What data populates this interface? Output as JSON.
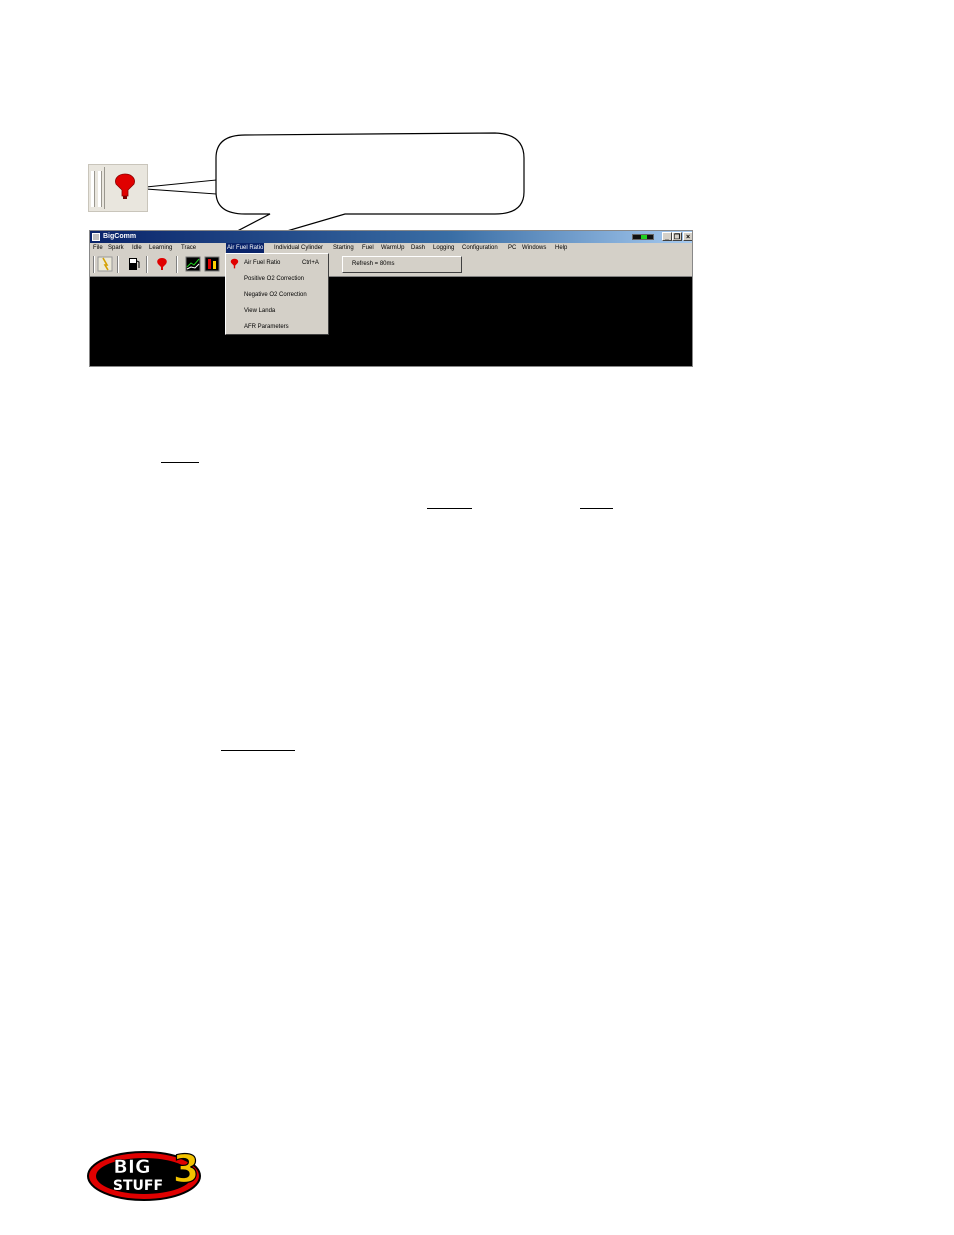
{
  "callout": {
    "text": "",
    "icon": "air-fuel-ratio-icon"
  },
  "window": {
    "title": "BigComm",
    "controls": {
      "minimize": "_",
      "restore": "❐",
      "close": "×"
    }
  },
  "menubar": {
    "items": [
      "File",
      "Spark",
      "Idle",
      "Learning",
      "Trace",
      "Air Fuel Ratio",
      "Individual Cylinder",
      "Starting",
      "Fuel",
      "WarmUp",
      "Dash",
      "Logging",
      "Configuration",
      "PC",
      "Windows",
      "Help"
    ],
    "active": "Air Fuel Ratio"
  },
  "toolbar": {
    "icons": [
      "wizard-icon",
      "fuel-pump-icon",
      "air-fuel-ratio-icon",
      "chart-icon",
      "cylinder-icon"
    ],
    "refresh_label": "Refresh = 80ms"
  },
  "dropdown": {
    "items": [
      {
        "label": "Air Fuel Ratio",
        "shortcut": "Ctrl+A",
        "icon": "air-fuel-ratio-icon"
      },
      {
        "label": "Positive O2 Correction",
        "shortcut": ""
      },
      {
        "label": "Negative O2 Correction",
        "shortcut": ""
      },
      {
        "label": "View Landa",
        "shortcut": ""
      },
      {
        "label": "AFR Parameters",
        "shortcut": ""
      }
    ]
  },
  "colors": {
    "titlebar_start": "#0a246a",
    "titlebar_end": "#a6caf0",
    "menu_bg": "#d4d0c8",
    "afr_icon": "#e00000",
    "window_bg": "#000000"
  },
  "logo": {
    "text_top": "BIG",
    "text_bottom": "STUFF",
    "number": "3"
  }
}
